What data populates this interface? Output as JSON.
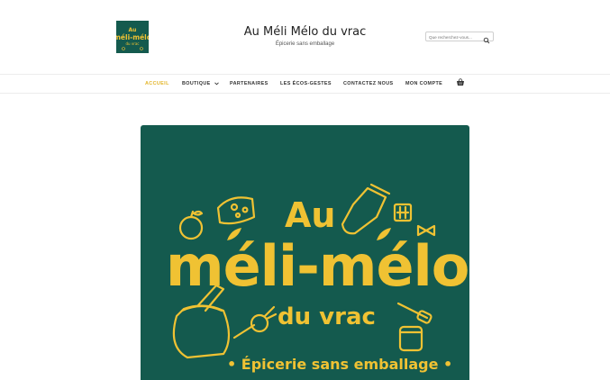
{
  "site": {
    "title": "Au Méli Mélo du vrac",
    "tagline": "Épicerie sans emballage",
    "logo_icon": "brand-logo"
  },
  "search": {
    "placeholder": "Que recherchez-vous...",
    "icon": "search-icon"
  },
  "nav": {
    "items": [
      {
        "label": "ACCUEIL",
        "active": true
      },
      {
        "label": "BOUTIQUE",
        "has_dropdown": true
      },
      {
        "label": "PARTENAIRES"
      },
      {
        "label": "LES ÉCOS-GESTES"
      },
      {
        "label": "CONTACTEZ NOUS"
      },
      {
        "label": "MON COMPTE"
      }
    ],
    "cart_icon": "basket-icon"
  },
  "hero": {
    "line1": "Au",
    "line2": "méli-mélo",
    "line3": "du vrac",
    "line4": "• Épicerie sans emballage •"
  },
  "colors": {
    "brand_green": "#145a4e",
    "brand_yellow": "#f0c233",
    "nav_active": "#e3b52a"
  }
}
